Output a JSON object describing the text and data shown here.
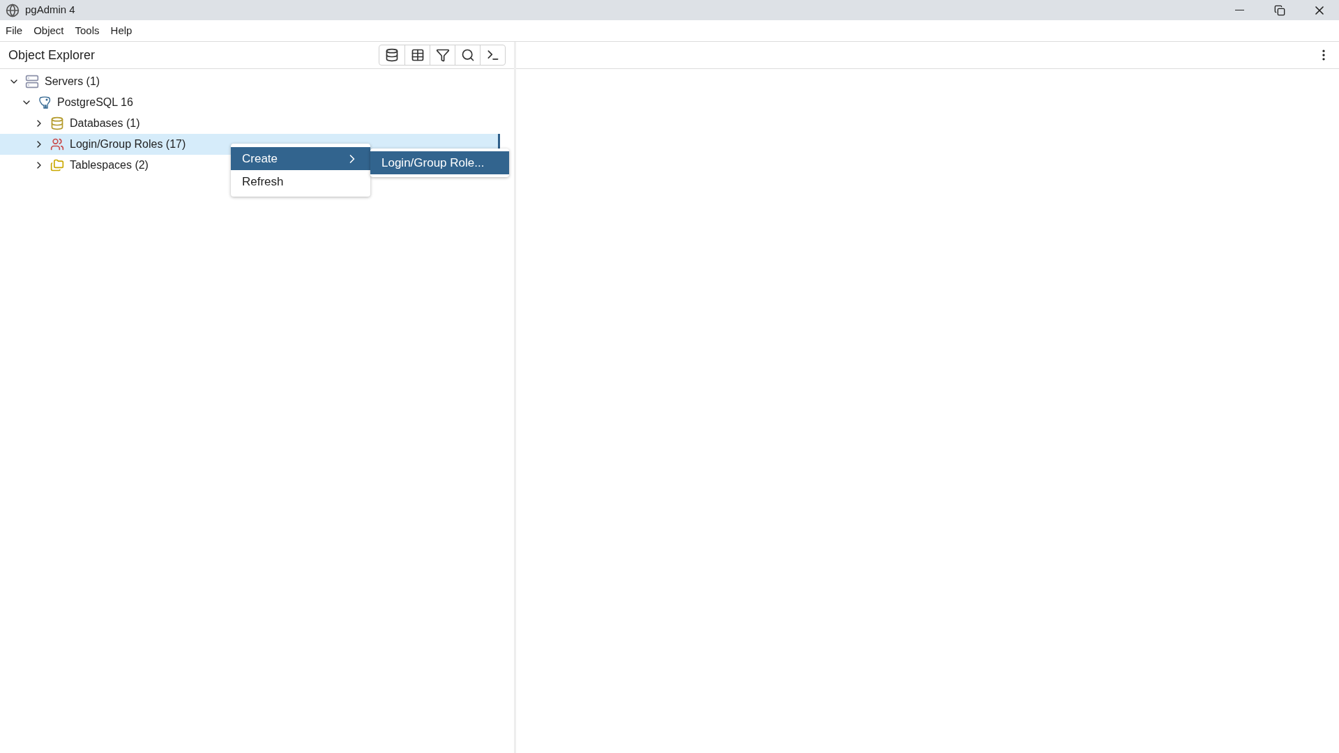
{
  "window": {
    "title": "pgAdmin 4"
  },
  "menu_bar": [
    "File",
    "Object",
    "Tools",
    "Help"
  ],
  "object_explorer": {
    "title": "Object Explorer"
  },
  "tree": [
    {
      "label": "Servers (1)",
      "kind": "servers",
      "expanded": true,
      "selected": false,
      "children": [
        {
          "label": "PostgreSQL 16",
          "kind": "server",
          "expanded": true,
          "selected": false,
          "children": [
            {
              "label": "Databases (1)",
              "kind": "databases",
              "expanded": false,
              "selected": false
            },
            {
              "label": "Login/Group Roles (17)",
              "kind": "roles",
              "expanded": false,
              "selected": true
            },
            {
              "label": "Tablespaces (2)",
              "kind": "tablespaces",
              "expanded": false,
              "selected": false
            }
          ]
        }
      ]
    }
  ],
  "context_menu": [
    {
      "label": "Create",
      "selected": true,
      "kind": "submenu"
    },
    {
      "label": "Refresh",
      "selected": false,
      "kind": "item"
    }
  ],
  "submenu": [
    {
      "label": "Login/Group Role...",
      "selected": true
    }
  ]
}
